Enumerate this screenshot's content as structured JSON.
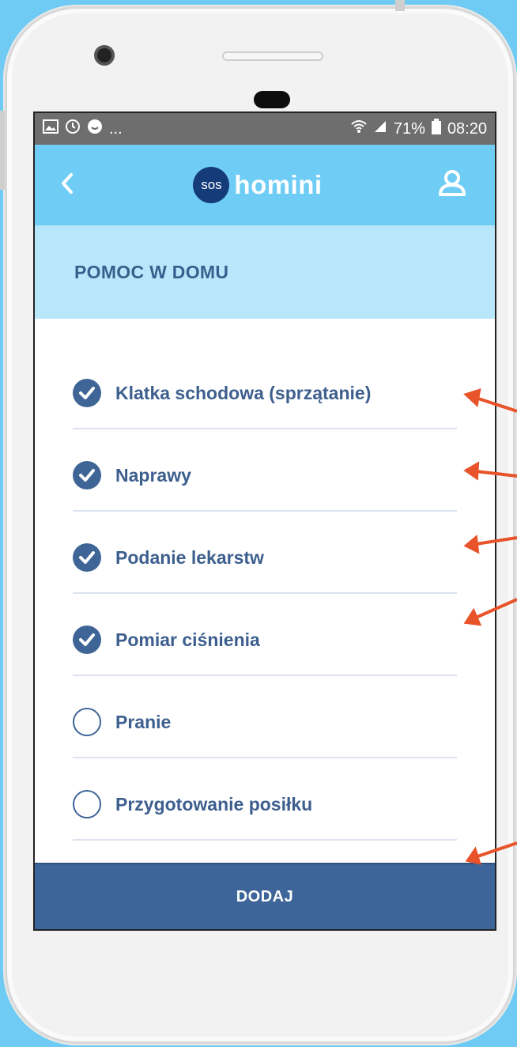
{
  "status_bar": {
    "left_icons": [
      "image-icon",
      "timer-icon",
      "face-icon"
    ],
    "more": "...",
    "battery": "71%",
    "time": "08:20"
  },
  "app_bar": {
    "logo_badge": "sos",
    "logo_text": "homini"
  },
  "section": {
    "title": "POMOC W DOMU"
  },
  "services": [
    {
      "label": "Klatka schodowa (sprzątanie)",
      "checked": true
    },
    {
      "label": "Naprawy",
      "checked": true
    },
    {
      "label": "Podanie lekarstw",
      "checked": true
    },
    {
      "label": "Pomiar ciśnienia",
      "checked": true
    },
    {
      "label": "Pranie",
      "checked": false
    },
    {
      "label": "Przygotowanie posiłku",
      "checked": false
    }
  ],
  "add_button": "DODAJ",
  "colors": {
    "background": "#6fcbf3",
    "app_bar": "#6fcdf5",
    "section_header": "#b8e6fb",
    "primary": "#3d6599",
    "annotation_arrow": "#e8532a"
  }
}
